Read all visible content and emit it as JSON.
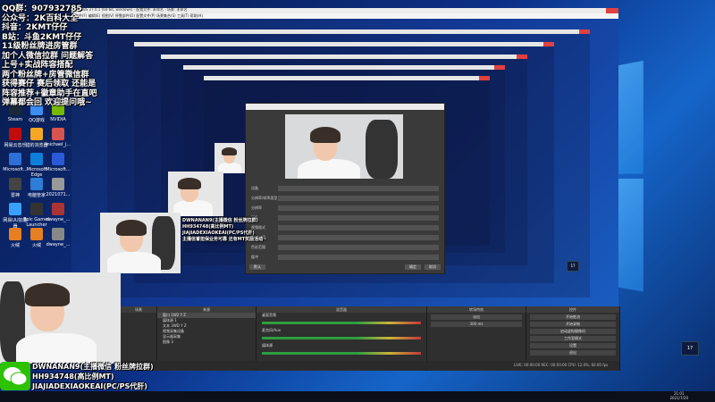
{
  "overlay": {
    "lines": [
      "QQ群：907932785",
      "公众号：2K百科大全",
      "抖音：2KMT仔仔",
      "B站：斗鱼2KMT仔仔",
      "11级粉丝牌进房管群",
      "加个人微信拉群 问题解答",
      "上号+实战阵容搭配",
      "两个粉丝牌+房管微信群",
      "获得赛仔 赛后领取 还能是",
      "阵容推荐+徽章助手在直吧",
      "弹幕都会回 欢迎提问哦~"
    ]
  },
  "desktop_icons": [
    "Steam",
    "QQ游戏",
    "NVIDIA",
    "网易云音乐",
    "猎豹浏览器",
    "michael_j...",
    "Microsoft...",
    "Microsoft Edge",
    "Microsoft...",
    "雷神",
    "电脑管家",
    "2021071...",
    "网易UU加速器",
    "Epic Games Launcher",
    "dwayne_...",
    "火绒",
    "火绒",
    "dwayne_..."
  ],
  "obs": {
    "title": "OBS 27.0.1 (64-bit, windows) - 配置文件: 未命名 - 场景: 未命名",
    "menu": "文件(F)  编辑(E)  视图(V)  停靠部件(D)  配置文件(P)  场景集合(S)  工具(T)  帮助(H)",
    "docks": {
      "scenes_header": "场景",
      "sources_header": "来源",
      "mixer_header": "混音器",
      "transitions_header": "转场特效",
      "controls_header": "控件"
    },
    "sources": [
      "窗口 1W2 Y Z",
      "媒体源 1",
      "文本 3WD Y Z",
      "视频采集设备",
      "显示器采集",
      "图像 3"
    ],
    "mixer": [
      "桌面音频",
      "麦克风/Aux",
      "媒体源"
    ],
    "transition": "淡出",
    "transition_duration": "300 ms",
    "controls": [
      "开始推流",
      "开始录制",
      "启动虚拟摄像机",
      "工作室模式",
      "设置",
      "退出"
    ],
    "status": "LIVE: 00:00:00   REC: 00:00:00   CPU: 12.0%, 60.00 fps"
  },
  "dialog": {
    "rows": [
      "设备",
      "分辨率/帧率类型",
      "分辨率",
      "FPS",
      "视频格式",
      "色彩空间",
      "色彩范围",
      "缓冲"
    ],
    "ok": "确定",
    "cancel": "取消",
    "defaults": "默认"
  },
  "chat": [
    {
      "name": "DWNANAN9(主播微信 粉丝牌拉群)"
    },
    {
      "name": "HH934748(高比例MT)"
    },
    {
      "name": "JIAJIADEXIAOKEAI(PC/PS代肝)"
    },
    {
      "name": "主播信誉担保业务可靠 还有MT奖励活动~"
    }
  ],
  "nested_chat_mini": [
    "DWNANAN9(主播微信 粉丝牌拉群)",
    "HH934748(高比例MT)",
    "JIAJIADEXIAOKEAI(PC/PS代肝)",
    "主播信誉担保业务可靠 还有MT奖励活动~"
  ],
  "side_button": "17",
  "small_button": "17",
  "clock": {
    "time": "21:01",
    "date": "2021/7/20"
  },
  "colors": {
    "obs_dark": "#2b2b2b",
    "title_red": "#e04040",
    "wechat": "#2dc100"
  }
}
